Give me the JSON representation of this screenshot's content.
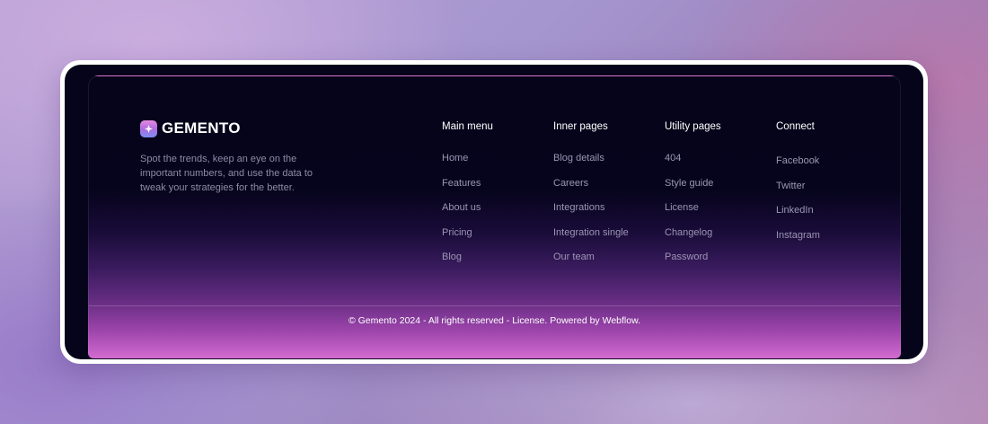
{
  "brand": {
    "name": "GEMENTO"
  },
  "tagline": "Spot the trends, keep an eye on the important numbers, and use the data to tweak your strategies for the better.",
  "columns": [
    {
      "title": "Main menu",
      "links": [
        "Home",
        "Features",
        "About us",
        "Pricing",
        "Blog"
      ]
    },
    {
      "title": "Inner pages",
      "links": [
        "Blog details",
        "Careers",
        "Integrations",
        "Integration single",
        "Our team"
      ]
    },
    {
      "title": "Utility pages",
      "links": [
        "404",
        "Style guide",
        "License",
        "Changelog",
        "Password"
      ]
    },
    {
      "title": "Connect",
      "links": [
        "Facebook",
        "Twitter",
        "LinkedIn",
        "Instagram"
      ]
    }
  ],
  "copyright": "© Gemento 2024 - All rights reserved - License. Powered by Webflow.",
  "colors": {
    "background_dark": "#06041a",
    "gradient_bottom": "#d36bd0",
    "link_muted": "#9b96b3",
    "heading": "#ffffff"
  },
  "icons": {
    "logo": "sparkle-arch-logo-icon"
  }
}
